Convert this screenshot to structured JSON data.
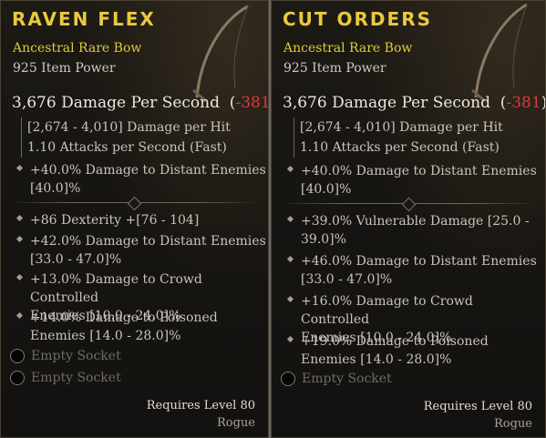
{
  "items": [
    {
      "name": "RAVEN FLEX",
      "type": "Ancestral Rare Bow",
      "item_power": "925 Item Power",
      "dps_text": "3,676 Damage Per Second",
      "dps_diff": "-381",
      "damage_per_hit": "[2,674 - 4,010] Damage per Hit",
      "attacks_per_second": "1.10 Attacks per Second (Fast)",
      "implicit": {
        "line1": "+40.0% Damage to Distant Enemies",
        "line2": "[40.0]%"
      },
      "affixes": [
        {
          "line1": "+86 Dexterity +[76 - 104]",
          "line2": ""
        },
        {
          "line1": "+42.0% Damage to Distant Enemies",
          "line2": "[33.0 - 47.0]%"
        },
        {
          "line1": "+13.0% Damage to Crowd Controlled",
          "line2": "Enemies [10.0 - 24.0]%"
        },
        {
          "line1": "+14.0% Damage to Poisoned",
          "line2": "Enemies [14.0 - 28.0]%"
        }
      ],
      "sockets": [
        "Empty Socket",
        "Empty Socket"
      ],
      "requires": "Requires Level 80",
      "class": "Rogue"
    },
    {
      "name": "CUT ORDERS",
      "type": "Ancestral Rare Bow",
      "item_power": "925 Item Power",
      "dps_text": "3,676 Damage Per Second",
      "dps_diff": "-381",
      "damage_per_hit": "[2,674 - 4,010] Damage per Hit",
      "attacks_per_second": "1.10 Attacks per Second (Fast)",
      "implicit": {
        "line1": "+40.0% Damage to Distant Enemies",
        "line2": "[40.0]%"
      },
      "affixes": [
        {
          "line1": "+39.0% Vulnerable Damage [25.0 -",
          "line2": "39.0]%"
        },
        {
          "line1": "+46.0% Damage to Distant Enemies",
          "line2": "[33.0 - 47.0]%"
        },
        {
          "line1": "+16.0% Damage to Crowd Controlled",
          "line2": "Enemies [10.0 - 24.0]%"
        },
        {
          "line1": "+19.0% Damage to Poisoned",
          "line2": "Enemies [14.0 - 28.0]%"
        }
      ],
      "sockets": [
        "Empty Socket"
      ],
      "requires": "Requires Level 80",
      "class": "Rogue"
    }
  ]
}
